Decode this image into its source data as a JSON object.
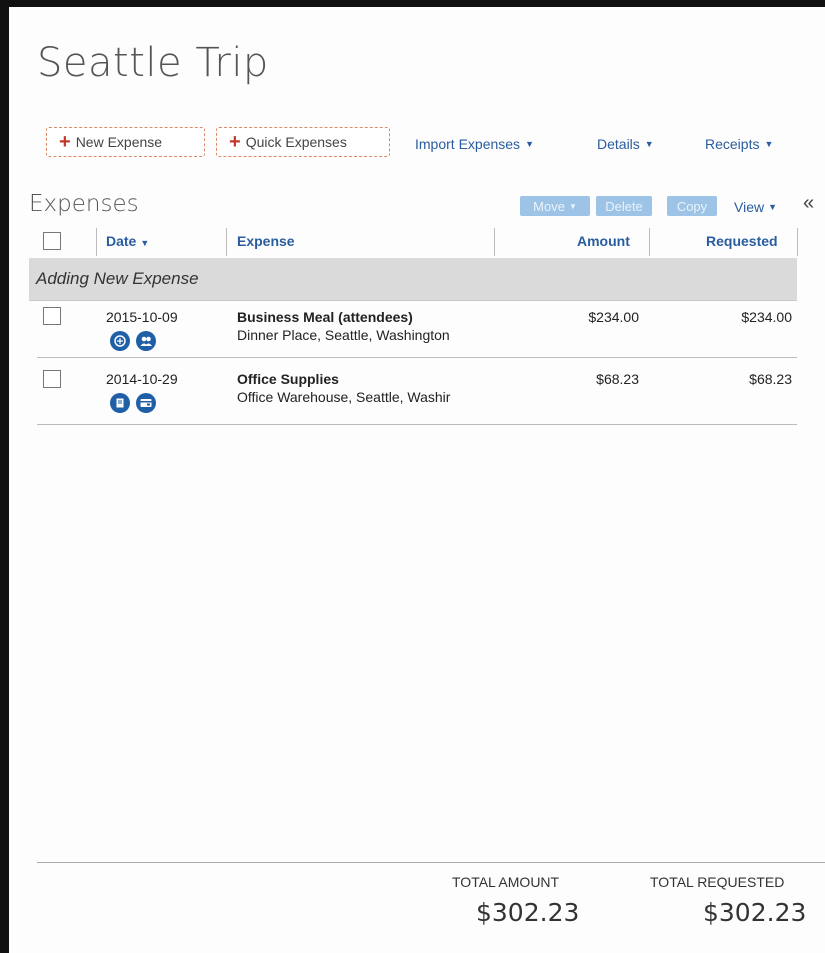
{
  "page": {
    "title": "Seattle Trip"
  },
  "toolbar": {
    "new_expense": "New Expense",
    "quick_expenses": "Quick Expenses",
    "import_expenses": "Import Expenses",
    "details": "Details",
    "receipts": "Receipts"
  },
  "expenses": {
    "title": "Expenses",
    "actions": {
      "move": "Move",
      "delete": "Delete",
      "copy": "Copy",
      "view": "View"
    },
    "columns": {
      "date": "Date",
      "expense": "Expense",
      "amount": "Amount",
      "requested": "Requested"
    },
    "group_label": "Adding New Expense",
    "rows": [
      {
        "date": "2015-10-09",
        "name": "Business Meal (attendees)",
        "location": "Dinner Place, Seattle, Washington",
        "amount": "$234.00",
        "requested": "$234.00",
        "icons": [
          "meal-icon",
          "attendees-icon"
        ]
      },
      {
        "date": "2014-10-29",
        "name": "Office Supplies",
        "location": "Office Warehouse, Seattle, Washir",
        "amount": "$68.23",
        "requested": "$68.23",
        "icons": [
          "receipt-icon",
          "card-icon"
        ]
      }
    ]
  },
  "totals": {
    "amount_label": "TOTAL AMOUNT",
    "amount_value": "$302.23",
    "requested_label": "TOTAL REQUESTED",
    "requested_value": "$302.23"
  },
  "colors": {
    "link": "#2a5d9f",
    "accent_red": "#c0392b",
    "disabled_button": "#9dc3e6",
    "icon_blue": "#1f5fa6"
  }
}
